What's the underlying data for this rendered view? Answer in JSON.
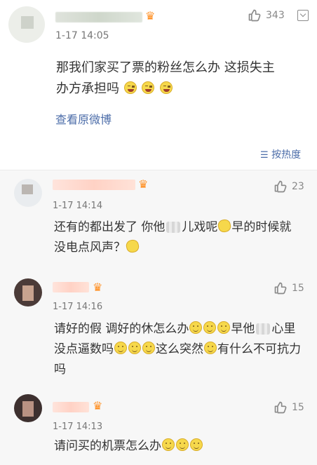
{
  "post": {
    "time": "1-17 14:05",
    "likes": "343",
    "text_line1": "那我们家买了票的粉丝怎么办 这损失主",
    "text_line2": "办方承担吗",
    "view_original": "查看原微博",
    "sort_label": "按热度",
    "sort_icon": "list-sort-icon"
  },
  "replies": [
    {
      "time": "1-17 14:14",
      "likes": "23",
      "line1_a": "还有的都出发了 你他",
      "line1_b": "儿戏呢",
      "line1_c": "早的时候就",
      "line2": "没电点风声？"
    },
    {
      "time": "1-17 14:16",
      "likes": "15",
      "line1_a": "请好的假 调好的休怎么办",
      "line1_b": "早他",
      "line1_c": "心里",
      "line2_a": "没点逼数吗",
      "line2_b": "这么突然",
      "line2_c": "有什么不可抗力",
      "line3": "吗"
    },
    {
      "time": "1-17 14:13",
      "likes": "15",
      "line1": "请问买的机票怎么办"
    }
  ],
  "icons": {
    "like": "thumb-up-icon",
    "menu": "dropdown-menu-icon",
    "badge": "member-crown-icon"
  }
}
